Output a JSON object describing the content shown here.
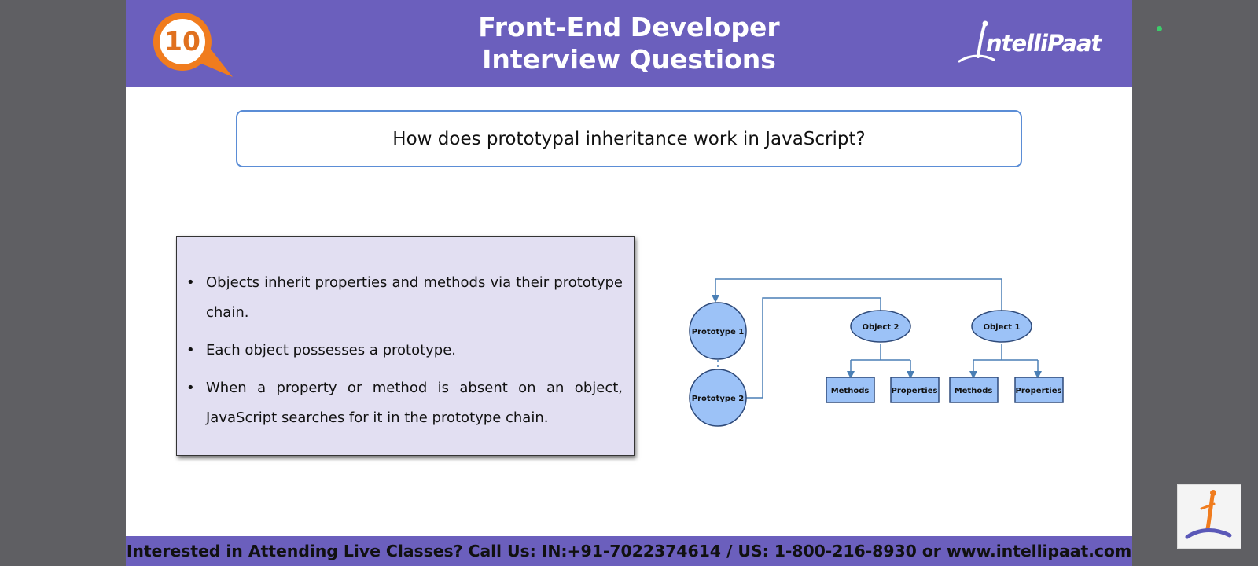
{
  "header": {
    "badge_number": "10",
    "title_line1": "Front-End Developer",
    "title_line2": "Interview Questions",
    "logo_text": "ntelliPaat"
  },
  "question": "How does prototypal inheritance work in JavaScript?",
  "bullets": [
    "Objects inherit properties and methods via their prototype chain.",
    "Each object possesses a prototype.",
    "When a property or method is absent on an object, JavaScript searches for it in the prototype chain."
  ],
  "diagram": {
    "prototype1": "Prototype 1",
    "prototype2": "Prototype 2",
    "object2": "Object 2",
    "object1": "Object 1",
    "methods": "Methods",
    "properties": "Properties"
  },
  "footer": "Interested in Attending Live Classes? Call Us: IN:+91-7022374614 / US: 1-800-216-8930 or www.intellipaat.com",
  "colors": {
    "header_bg": "#6b5fbd",
    "badge_orange": "#f07c1e",
    "node_fill": "#9cc2f7",
    "node_stroke": "#2e4a7a",
    "connector": "#4a7fb5"
  }
}
